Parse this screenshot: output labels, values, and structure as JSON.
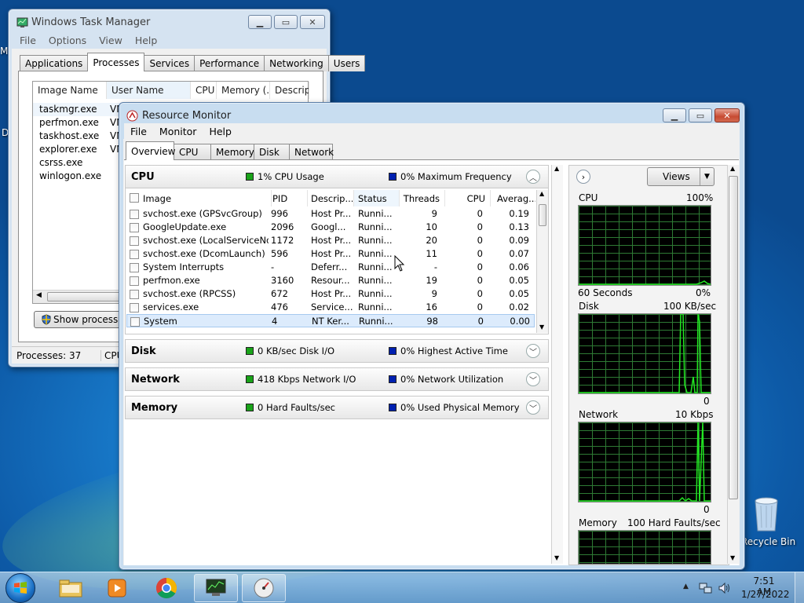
{
  "desktop": {
    "recycle_bin_label": "Recycle Bin",
    "left_edge_letters": [
      "M",
      "D"
    ]
  },
  "task_manager": {
    "title": "Windows Task Manager",
    "menu": [
      "File",
      "Options",
      "View",
      "Help"
    ],
    "tabs": [
      "Applications",
      "Processes",
      "Services",
      "Performance",
      "Networking",
      "Users"
    ],
    "active_tab": "Processes",
    "columns": [
      "Image Name",
      "User Name",
      "CPU",
      "Memory (...",
      "Descripti"
    ],
    "rows": [
      {
        "image": "taskmgr.exe",
        "user": "VM"
      },
      {
        "image": "perfmon.exe",
        "user": "VM"
      },
      {
        "image": "taskhost.exe",
        "user": "VM"
      },
      {
        "image": "explorer.exe",
        "user": "VM"
      },
      {
        "image": "csrss.exe",
        "user": ""
      },
      {
        "image": "winlogon.exe",
        "user": ""
      }
    ],
    "show_processes_button": "Show processes f",
    "status_processes": "Processes: 37",
    "status_cpu": "CPU"
  },
  "resource_monitor": {
    "title": "Resource Monitor",
    "menu": [
      "File",
      "Monitor",
      "Help"
    ],
    "tabs": [
      "Overview",
      "CPU",
      "Memory",
      "Disk",
      "Network"
    ],
    "active_tab": "Overview",
    "cpu_section": {
      "name": "CPU",
      "usage": "1% CPU Usage",
      "freq": "0% Maximum Frequency"
    },
    "columns": [
      "Image",
      "PID",
      "Descrip...",
      "Status",
      "Threads",
      "CPU",
      "Averag..."
    ],
    "rows": [
      {
        "image": "svchost.exe (GPSvcGroup)",
        "pid": "996",
        "desc": "Host Pr...",
        "status": "Runni...",
        "threads": "9",
        "cpu": "0",
        "avg": "0.19"
      },
      {
        "image": "GoogleUpdate.exe",
        "pid": "2096",
        "desc": "Googl...",
        "status": "Runni...",
        "threads": "10",
        "cpu": "0",
        "avg": "0.13"
      },
      {
        "image": "svchost.exe (LocalServiceNo...",
        "pid": "1172",
        "desc": "Host Pr...",
        "status": "Runni...",
        "threads": "20",
        "cpu": "0",
        "avg": "0.09"
      },
      {
        "image": "svchost.exe (DcomLaunch)",
        "pid": "596",
        "desc": "Host Pr...",
        "status": "Runni...",
        "threads": "11",
        "cpu": "0",
        "avg": "0.07"
      },
      {
        "image": "System Interrupts",
        "pid": "-",
        "desc": "Deferr...",
        "status": "Runni...",
        "threads": "-",
        "cpu": "0",
        "avg": "0.06"
      },
      {
        "image": "perfmon.exe",
        "pid": "3160",
        "desc": "Resour...",
        "status": "Runni...",
        "threads": "19",
        "cpu": "0",
        "avg": "0.05"
      },
      {
        "image": "svchost.exe (RPCSS)",
        "pid": "672",
        "desc": "Host Pr...",
        "status": "Runni...",
        "threads": "9",
        "cpu": "0",
        "avg": "0.05"
      },
      {
        "image": "services.exe",
        "pid": "476",
        "desc": "Service...",
        "status": "Runni...",
        "threads": "16",
        "cpu": "0",
        "avg": "0.02"
      },
      {
        "image": "System",
        "pid": "4",
        "desc": "NT Ker...",
        "status": "Runni...",
        "threads": "98",
        "cpu": "0",
        "avg": "0.00"
      }
    ],
    "disk_section": {
      "name": "Disk",
      "io": "0 KB/sec Disk I/O",
      "active": "0% Highest Active Time"
    },
    "network_section": {
      "name": "Network",
      "io": "418 Kbps Network I/O",
      "util": "0% Network Utilization"
    },
    "memory_section": {
      "name": "Memory",
      "faults": "0 Hard Faults/sec",
      "used": "0% Used Physical Memory"
    },
    "views_button": "Views",
    "graphs": {
      "cpu": {
        "label": "CPU",
        "max": "100%",
        "time": "60 Seconds",
        "current": "0%"
      },
      "disk": {
        "label": "Disk",
        "max": "100 KB/sec",
        "current": "0"
      },
      "network": {
        "label": "Network",
        "max": "10 Kbps",
        "current": "0"
      },
      "memory": {
        "label": "Memory",
        "max": "100 Hard Faults/sec"
      }
    }
  },
  "taskbar": {
    "time": "7:51 AM",
    "date": "1/27/2022"
  },
  "colors": {
    "legend_green": "#19a319",
    "legend_blue": "#0020b0",
    "graph_line": "#22e822",
    "taskbar": "#8db4d8"
  }
}
